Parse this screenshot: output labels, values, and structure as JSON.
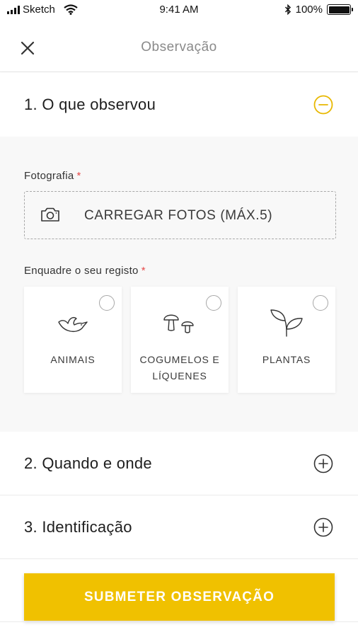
{
  "status_bar": {
    "carrier": "Sketch",
    "time": "9:41 AM",
    "battery": "100%",
    "battery_level": 1.0,
    "icons": [
      "signal-icon",
      "wifi-icon",
      "bluetooth-icon",
      "battery-icon"
    ]
  },
  "nav": {
    "title": "Observação",
    "close_icon": "close-icon"
  },
  "sections": [
    {
      "title": "1. O que observou",
      "expanded": true,
      "toggle_icon": "minus-circle-icon"
    },
    {
      "title": "2. Quando e onde",
      "expanded": false,
      "toggle_icon": "plus-circle-icon"
    },
    {
      "title": "3. Identificação",
      "expanded": false,
      "toggle_icon": "plus-circle-icon"
    }
  ],
  "photo": {
    "label": "Fotografia",
    "required_mark": "*",
    "upload_label": "CARREGAR FOTOS (MÁX.5)",
    "upload_icon": "camera-icon"
  },
  "frame": {
    "label": "Enquadre o seu registo",
    "required_mark": "*",
    "options": [
      {
        "label": "ANIMAIS",
        "icon": "bird-icon",
        "selected": false
      },
      {
        "label": "COGUMELOS E LÍQUENES",
        "icon": "mushroom-icon",
        "selected": false
      },
      {
        "label": "PLANTAS",
        "icon": "sprout-icon",
        "selected": false
      }
    ]
  },
  "submit": {
    "label": "SUBMETER OBSERVAÇÃO"
  },
  "colors": {
    "accent": "#f0c100",
    "required": "#e64a4a",
    "panel_background": "#f8f8f8",
    "text": "#1e1e1e",
    "muted": "#8a8a8a"
  }
}
